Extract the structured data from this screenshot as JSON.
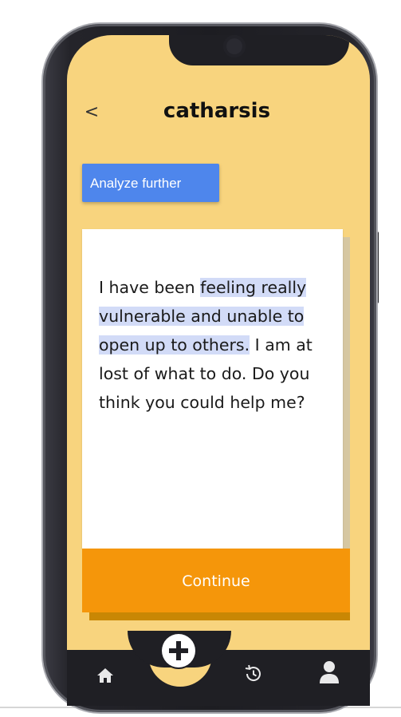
{
  "app": {
    "title": "catharsis",
    "back_label": "<"
  },
  "actions": {
    "analyze_label": "Analyze further",
    "continue_label": "Continue"
  },
  "entry": {
    "before_highlight": "I have been ",
    "highlight": "feeling really vulnerable and unable to open up to others.",
    "after_highlight": " I am at lost of what to do. Do you think you could help me?"
  },
  "nav": {
    "items": [
      {
        "icon": "home-icon"
      },
      {
        "icon": "plus-icon"
      },
      {
        "icon": "history-icon"
      },
      {
        "icon": "profile-icon"
      }
    ]
  },
  "colors": {
    "background": "#f8d47e",
    "analyze_button": "#4e86ec",
    "continue_button": "#f5960a",
    "highlight": "#d2dbf7",
    "nav_bar": "#1f1f24"
  }
}
